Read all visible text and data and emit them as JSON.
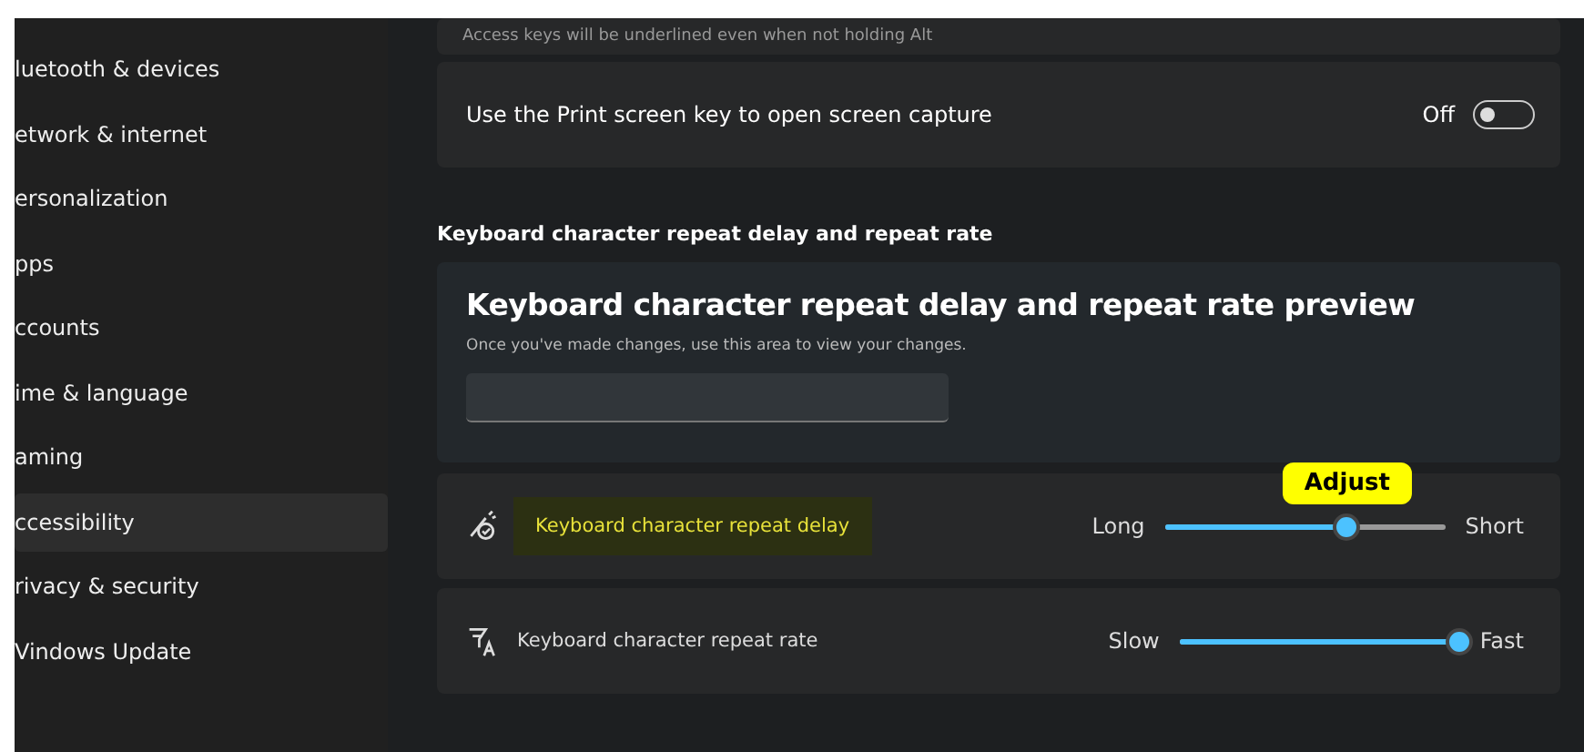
{
  "sidebar": {
    "items": [
      {
        "label": "luetooth & devices",
        "selected": false
      },
      {
        "label": "etwork & internet",
        "selected": false
      },
      {
        "label": "ersonalization",
        "selected": false
      },
      {
        "label": "pps",
        "selected": false
      },
      {
        "label": "ccounts",
        "selected": false
      },
      {
        "label": "ime & language",
        "selected": false
      },
      {
        "label": "aming",
        "selected": false
      },
      {
        "label": "ccessibility",
        "selected": true
      },
      {
        "label": "rivacy & security",
        "selected": false
      },
      {
        "label": "Vindows Update",
        "selected": false
      }
    ]
  },
  "top_card": {
    "description": "Access keys will be underlined even when not holding Alt"
  },
  "print_screen": {
    "label": "Use the Print screen key to open screen capture",
    "state_label": "Off",
    "on": false
  },
  "section_title": "Keyboard character repeat delay and repeat rate",
  "preview": {
    "title": "Keyboard character repeat delay and repeat rate preview",
    "description": "Once you've made changes, use this area to view your changes."
  },
  "sliders": [
    {
      "kind": "delay",
      "label": "Keyboard character repeat delay",
      "highlighted": true,
      "min_label": "Long",
      "max_label": "Short",
      "level": 0.65,
      "callout": "Adjust"
    },
    {
      "kind": "rate",
      "label": "Keyboard character repeat rate",
      "highlighted": false,
      "min_label": "Slow",
      "max_label": "Fast",
      "level": 1
    }
  ]
}
